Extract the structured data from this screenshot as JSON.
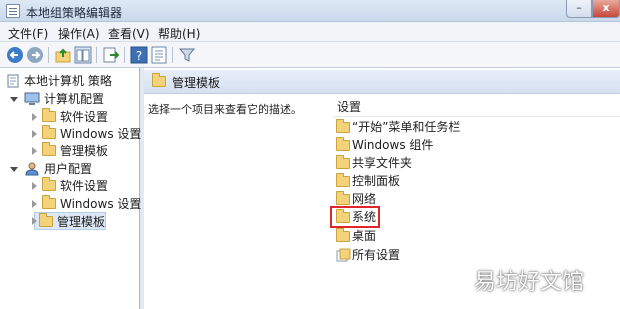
{
  "window": {
    "title": "本地组策略编辑器",
    "minimize_glyph": "–",
    "close_glyph": "x"
  },
  "menu": [
    "文件(F)",
    "操作(A)",
    "查看(V)",
    "帮助(H)"
  ],
  "toolbar_icons": [
    "back-arrow-icon",
    "forward-arrow-icon",
    "up-folder-icon",
    "show-hide-tree-icon",
    "export-list-icon",
    "help-icon",
    "properties-icon",
    "filter-icon"
  ],
  "tree": {
    "root": "本地计算机 策略",
    "computer_config": "计算机配置",
    "computer_children": [
      "软件设置",
      "Windows 设置",
      "管理模板"
    ],
    "user_config": "用户配置",
    "user_children": [
      "软件设置",
      "Windows 设置",
      "管理模板"
    ]
  },
  "content": {
    "header": "管理模板",
    "description": "选择一个项目来查看它的描述。",
    "column": "设置",
    "items": [
      "“开始”菜单和任务栏",
      "Windows 组件",
      "共享文件夹",
      "控制面板",
      "网络",
      "系统",
      "桌面",
      "所有设置"
    ],
    "highlighted": "系统"
  },
  "watermark": "易坊好文馆",
  "colors": {
    "highlight_border": "#e0262a",
    "folder": "#f4d27a",
    "selection": "#dde8f6"
  }
}
